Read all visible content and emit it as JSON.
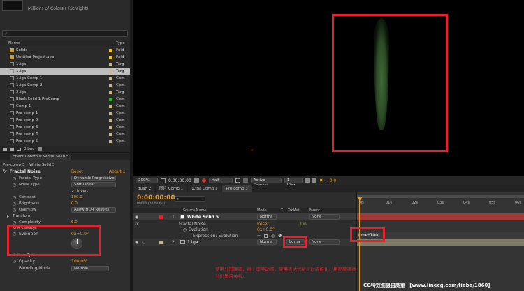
{
  "colors": {
    "accent": "#e49a2d",
    "annotation": "#e0232c",
    "label_blue": "#6b8fc8",
    "label_purple": "#a0a0d8",
    "label_gray": "#c4b89a",
    "label_green": "#3aa53a"
  },
  "project": {
    "thumb_title": "",
    "thumb_info": "Millions of Colors+ (Straight)",
    "search_placeholder": "",
    "col_name": "Name",
    "col_type": "Type",
    "items": [
      {
        "name": "Solids",
        "type": "Fold",
        "icon": "folder-icon",
        "color": "#e6c24a",
        "sel": false
      },
      {
        "name": "Untitled Project.aep",
        "type": "Fold",
        "icon": "folder-icon",
        "color": "#e6c24a",
        "sel": false
      },
      {
        "name": "1.tga",
        "type": "Targ",
        "icon": "footage-icon",
        "color": "#c4b89a",
        "sel": false
      },
      {
        "name": "1.tga",
        "type": "Targ",
        "icon": "footage-icon",
        "color": "#c4b89a",
        "sel": true
      },
      {
        "name": "1.tga Comp 1",
        "type": "Com",
        "icon": "comp-icon",
        "color": "#c4b89a",
        "sel": false
      },
      {
        "name": "1.tga Comp 2",
        "type": "Com",
        "icon": "comp-icon",
        "color": "#c4b89a",
        "sel": false
      },
      {
        "name": "2.tga",
        "type": "Targ",
        "icon": "footage-icon",
        "color": "#c4b89a",
        "sel": false
      },
      {
        "name": "Black Solid 1 PreComp",
        "type": "Com",
        "icon": "comp-icon",
        "color": "#3aa53a",
        "sel": false
      },
      {
        "name": "Comp 1",
        "type": "Com",
        "icon": "comp-icon",
        "color": "#c4b89a",
        "sel": false
      },
      {
        "name": "Pre-comp 1",
        "type": "Com",
        "icon": "comp-icon",
        "color": "#c4b89a",
        "sel": false
      },
      {
        "name": "Pre-comp 2",
        "type": "Com",
        "icon": "comp-icon",
        "color": "#c4b89a",
        "sel": false
      },
      {
        "name": "Pre-comp 3",
        "type": "Com",
        "icon": "comp-icon",
        "color": "#c4b89a",
        "sel": false
      },
      {
        "name": "Pre-comp 4",
        "type": "Com",
        "icon": "comp-icon",
        "color": "#c4b89a",
        "sel": false
      },
      {
        "name": "Pre-comp 5",
        "type": "Com",
        "icon": "comp-icon",
        "color": "#c4b89a",
        "sel": false
      }
    ],
    "footer_bpc": "8 bpc"
  },
  "effect_controls": {
    "tab": "Effect Controls: White Solid 5",
    "breadcrumb": "Pre-comp 3 • White Solid 5",
    "effect_name": "Fractal Noise",
    "reset": "Reset",
    "about": "About...",
    "props": [
      {
        "name": "Fractal Type",
        "value": "Dynamic Progressive",
        "kind": "dropdown"
      },
      {
        "name": "Noise Type",
        "value": "Soft Linear",
        "kind": "dropdown"
      },
      {
        "name": "",
        "value": "Invert",
        "kind": "checkbox"
      },
      {
        "name": "Contrast",
        "value": "100.0",
        "kind": "number"
      },
      {
        "name": "Brightness",
        "value": "0.0",
        "kind": "number"
      },
      {
        "name": "Overflow",
        "value": "Allow HDR Results",
        "kind": "dropdown"
      },
      {
        "name": "Transform",
        "value": "",
        "kind": "group"
      },
      {
        "name": "Complexity",
        "value": "6.0",
        "kind": "number"
      },
      {
        "name": "Sub Settings",
        "value": "",
        "kind": "group"
      }
    ],
    "evolution_label": "Evolution",
    "evolution_value": "0x+0.0°",
    "evolution_options": "Evolution Options",
    "opacity_label": "Opacity",
    "opacity_value": "100.0%",
    "blend_label": "Blending Mode",
    "blend_value": "Normal"
  },
  "viewer": {
    "zoom": "200%",
    "timecode": "0:00:00:00",
    "resolution": "Half",
    "camera": "Active Camera",
    "views": "1 View",
    "exposure": "+0.0"
  },
  "timeline": {
    "tabs": [
      "guan 2",
      "图片 Comp 1",
      "1.tga Comp 1",
      "Pre-comp 3"
    ],
    "timecode": "0:00:00:00",
    "fps": "00000 (24.00 fps)",
    "col_source": "Source Name",
    "col_mode": "Mode",
    "col_t": "T",
    "col_trkmat": "TrkMat",
    "col_parent": "Parent",
    "ruler": [
      "0s",
      "01s",
      "02s",
      "03s",
      "04s",
      "05s",
      "06s"
    ],
    "layer1": {
      "num": "1",
      "name": "White Solid 5",
      "mode": "Norma",
      "parent": "None"
    },
    "fractal": {
      "name": "Fractal Noise",
      "reset": "Reset",
      "extra": "Lin"
    },
    "evo": {
      "name": "Evolution",
      "value": "0x+0.0°"
    },
    "expr": {
      "name": "Expression: Evolution",
      "code": "time*100"
    },
    "layer2": {
      "num": "2",
      "name": "1.tga",
      "mode": "Norma",
      "trkmat": "Luma",
      "parent": "None"
    }
  },
  "annotation": "使用分形噪波，给上渐变动画，使用表达式给上时间倍化，用亮度遮罩，分出黑白关系。",
  "watermark": "CG特效图摄自威望 【www.linecg.com/tieba/1860】"
}
